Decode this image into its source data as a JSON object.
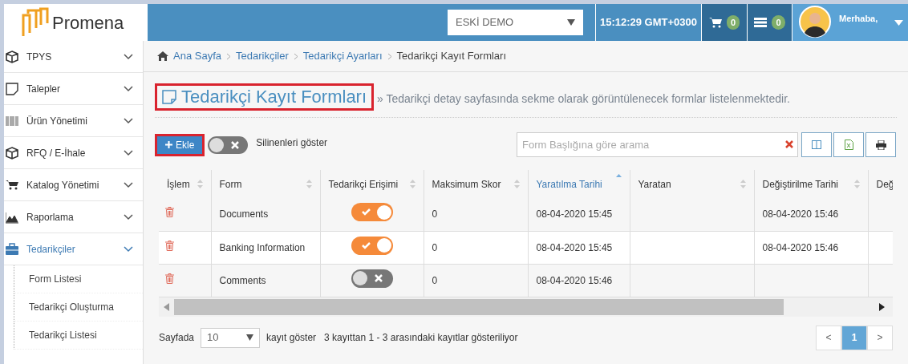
{
  "logo": {
    "text": "Promena"
  },
  "header": {
    "company_select": "ESKİ DEMO",
    "clock": "15:12:29 GMT+0300",
    "cart_count": "0",
    "server_count": "0",
    "greeting": "Merhaba,"
  },
  "sidebar": {
    "items": [
      {
        "label": "TPYS",
        "selected": false
      },
      {
        "label": "Talepler",
        "selected": false
      },
      {
        "label": "Ürün Yönetimi",
        "selected": false
      },
      {
        "label": "RFQ / E-İhale",
        "selected": false
      },
      {
        "label": "Katalog Yönetimi",
        "selected": false
      },
      {
        "label": "Raporlama",
        "selected": false
      },
      {
        "label": "Tedarikçiler",
        "selected": true,
        "children": [
          {
            "label": "Form Listesi"
          },
          {
            "label": "Tedarikçi Oluşturma"
          },
          {
            "label": "Tedarikçi Listesi"
          }
        ]
      }
    ]
  },
  "breadcrumb": [
    {
      "label": "Ana Sayfa",
      "link": true
    },
    {
      "label": "Tedarikçiler",
      "link": true
    },
    {
      "label": "Tedarikçi Ayarları",
      "link": true
    },
    {
      "label": "Tedarikçi Kayıt Formları",
      "link": false
    }
  ],
  "page": {
    "title": "Tedarikçi Kayıt Formları",
    "subtitle": "» Tedarikçi detay sayfasında sekme olarak görüntülenecek formlar listelenmektedir."
  },
  "toolbar": {
    "add_button": "Ekle",
    "show_deleted": {
      "label": "Silinenleri göster",
      "on": false
    },
    "search": {
      "placeholder": "Form Başlığına göre arama"
    }
  },
  "table": {
    "columns": [
      {
        "label": "İşlem",
        "sorted": false
      },
      {
        "label": "Form",
        "sorted": false
      },
      {
        "label": "Tedarikçi Erişimi",
        "sorted": false
      },
      {
        "label": "Maksimum Skor",
        "sorted": false
      },
      {
        "label": "Yaratılma Tarihi",
        "sorted": true
      },
      {
        "label": "Yaratan",
        "sorted": false
      },
      {
        "label": "Değiştirilme Tarihi",
        "sorted": false
      },
      {
        "label": "Değ",
        "sorted": false
      }
    ],
    "rows": [
      {
        "form": "Documents",
        "supplier_access": true,
        "max_score": "0",
        "created": "08-04-2020 15:45",
        "modified": "08-04-2020 15:46"
      },
      {
        "form": "Banking Information",
        "supplier_access": true,
        "max_score": "0",
        "created": "08-04-2020 15:45",
        "modified": "08-04-2020 15:46"
      },
      {
        "form": "Comments",
        "supplier_access": false,
        "max_score": "0",
        "created": "08-04-2020 15:46"
      }
    ]
  },
  "footer": {
    "per_page_label": "Sayfada",
    "per_page": "10",
    "show_label": "kayıt göster",
    "summary": "3 kayıttan 1 - 3 arasındaki kayıtlar gösteriliyor",
    "pagination": [
      {
        "label": "<",
        "selected": false
      },
      {
        "label": "1",
        "selected": true
      },
      {
        "label": ">",
        "selected": false
      }
    ]
  }
}
